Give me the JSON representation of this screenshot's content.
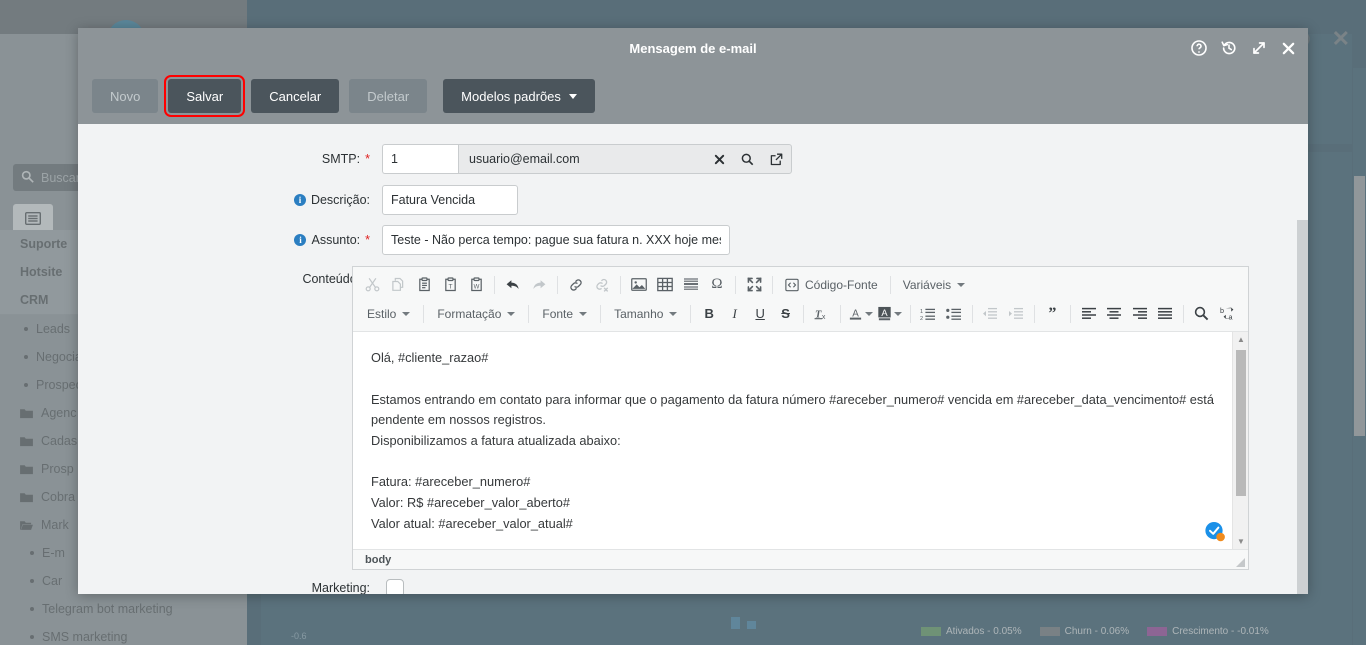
{
  "background": {
    "search_placeholder": "Buscar",
    "search_icon": "search-icon",
    "tab_icon": "list-view-icon",
    "nav_headings": [
      "Suporte",
      "Hotsite",
      "CRM"
    ],
    "nav_items": [
      {
        "label": "Leads",
        "type": "bullet"
      },
      {
        "label": "Negocia",
        "type": "bullet"
      },
      {
        "label": "Prospec",
        "type": "bullet"
      },
      {
        "label": "Agenc",
        "type": "folder"
      },
      {
        "label": "Cadas",
        "type": "folder"
      },
      {
        "label": "Prosp",
        "type": "folder"
      },
      {
        "label": "Cobra",
        "type": "folder"
      },
      {
        "label": "Mark",
        "type": "folder-open"
      },
      {
        "label": "E-m",
        "type": "bullet2"
      },
      {
        "label": "Car",
        "type": "bullet2"
      },
      {
        "label": "Telegram bot marketing",
        "type": "bullet2"
      },
      {
        "label": "SMS marketing",
        "type": "bullet2"
      }
    ],
    "chart_legend": [
      {
        "label": "Ativados - 0.05%",
        "color": "#3f8f3f"
      },
      {
        "label": "Churn - 0.06%",
        "color": "#5a6268"
      },
      {
        "label": "Crescimento - -0.01%",
        "color": "#8e1a8e"
      }
    ],
    "axis_label": "-0.6",
    "close_icon": "close-icon",
    "help_icon": "help-icon"
  },
  "modal": {
    "title": "Mensagem de e-mail",
    "header_actions": [
      {
        "name": "help-icon",
        "title": "Ajuda"
      },
      {
        "name": "history-icon",
        "title": "Histórico"
      },
      {
        "name": "expand-icon",
        "title": "Expandir"
      },
      {
        "name": "close-icon",
        "title": "Fechar"
      }
    ],
    "toolbar": {
      "novo_label": "Novo",
      "salvar_label": "Salvar",
      "cancelar_label": "Cancelar",
      "deletar_label": "Deletar",
      "modelos_label": "Modelos padrões"
    },
    "form": {
      "smtp_label": "SMTP:",
      "smtp_id_value": "1",
      "smtp_name_value": "usuario@email.com",
      "smtp_clear_icon": "clear-x-icon",
      "smtp_search_icon": "search-icon",
      "smtp_open_icon": "open-external-icon",
      "descricao_label": "Descrição:",
      "descricao_value": "Fatura Vencida",
      "assunto_label": "Assunto:",
      "assunto_value": "Teste - Não perca tempo: pague sua fatura n. XXX hoje mes",
      "conteudo_label": "Conteúdo:",
      "marketing_label": "Marketing:",
      "marketing_checked": false,
      "required_marker": "*"
    },
    "editor": {
      "toolbar_row1": [
        {
          "name": "cut-icon",
          "label": "Cortar",
          "disabled": true
        },
        {
          "name": "copy-icon",
          "label": "Copiar",
          "disabled": true
        },
        {
          "name": "paste-icon",
          "label": "Colar",
          "disabled": false
        },
        {
          "name": "paste-text-icon",
          "label": "Colar como texto sem formatação",
          "disabled": false
        },
        {
          "name": "paste-word-icon",
          "label": "Colar do Word",
          "disabled": false
        },
        {
          "name": "separator",
          "label": "",
          "disabled": false
        },
        {
          "name": "undo-icon",
          "label": "Desfazer",
          "disabled": false
        },
        {
          "name": "redo-icon",
          "label": "Refazer",
          "disabled": true
        },
        {
          "name": "separator",
          "label": "",
          "disabled": false
        },
        {
          "name": "link-icon",
          "label": "Link",
          "disabled": false
        },
        {
          "name": "unlink-icon",
          "label": "Remover link",
          "disabled": true
        },
        {
          "name": "separator",
          "label": "",
          "disabled": false
        },
        {
          "name": "image-icon",
          "label": "Imagem",
          "disabled": false
        },
        {
          "name": "table-icon",
          "label": "Tabela",
          "disabled": false
        },
        {
          "name": "horizontal-rule-icon",
          "label": "Linha horizontal",
          "disabled": false
        },
        {
          "name": "special-char-icon",
          "label": "Caractere especial",
          "disabled": false
        },
        {
          "name": "separator",
          "label": "",
          "disabled": false
        },
        {
          "name": "maximize-icon",
          "label": "Maximizar",
          "disabled": false
        }
      ],
      "source_label": "Código-Fonte",
      "source_icon": "source-code-icon",
      "variables_label": "Variáveis",
      "combos": [
        "Estilo",
        "Formatação",
        "Fonte",
        "Tamanho"
      ],
      "toolbar_row2": [
        {
          "name": "bold-icon",
          "label": "Negrito",
          "glyph": "B"
        },
        {
          "name": "italic-icon",
          "label": "Itálico",
          "glyph": "I"
        },
        {
          "name": "underline-icon",
          "label": "Sublinhado",
          "glyph": "U"
        },
        {
          "name": "strikethrough-icon",
          "label": "Tachado",
          "glyph": "S"
        },
        {
          "name": "remove-format-icon",
          "label": "Remover formatação",
          "glyph": "Tx"
        },
        {
          "name": "text-color-icon",
          "label": "Cor do texto",
          "glyph": "A"
        },
        {
          "name": "background-color-icon",
          "label": "Cor do fundo",
          "glyph": "A"
        },
        {
          "name": "numbered-list-icon",
          "label": "Lista numerada",
          "glyph": ""
        },
        {
          "name": "bulleted-list-icon",
          "label": "Lista com marcadores",
          "glyph": ""
        },
        {
          "name": "decrease-indent-icon",
          "label": "Diminuir recuo",
          "glyph": ""
        },
        {
          "name": "increase-indent-icon",
          "label": "Aumentar recuo",
          "glyph": ""
        },
        {
          "name": "blockquote-icon",
          "label": "Citação",
          "glyph": ""
        },
        {
          "name": "align-left-icon",
          "label": "Alinhar à esquerda",
          "glyph": ""
        },
        {
          "name": "align-center-icon",
          "label": "Centralizar",
          "glyph": ""
        },
        {
          "name": "align-right-icon",
          "label": "Alinhar à direita",
          "glyph": ""
        },
        {
          "name": "justify-icon",
          "label": "Justificar",
          "glyph": ""
        },
        {
          "name": "find-icon",
          "label": "Localizar",
          "glyph": ""
        },
        {
          "name": "replace-icon",
          "label": "Substituir",
          "glyph": ""
        }
      ],
      "content_lines": {
        "l1": "Olá, #cliente_razao#",
        "l2": "Estamos entrando em contato para informar que o pagamento da fatura número #areceber_numero# vencida em #areceber_data_vencimento# está pendente em nossos registros.",
        "l3": "Disponibilizamos a fatura atualizada abaixo:",
        "l4": "Fatura: #areceber_numero#",
        "l5": "Valor: R$ #areceber_valor_aberto#",
        "l6": "Valor atual: #areceber_valor_atual#"
      },
      "path_label": "body",
      "badge_icon": "spellcheck-badge-icon",
      "resize_grip_icon": "resize-grip-icon",
      "scroll_up_icon": "scroll-up-icon",
      "scroll_down_icon": "scroll-down-icon"
    }
  }
}
